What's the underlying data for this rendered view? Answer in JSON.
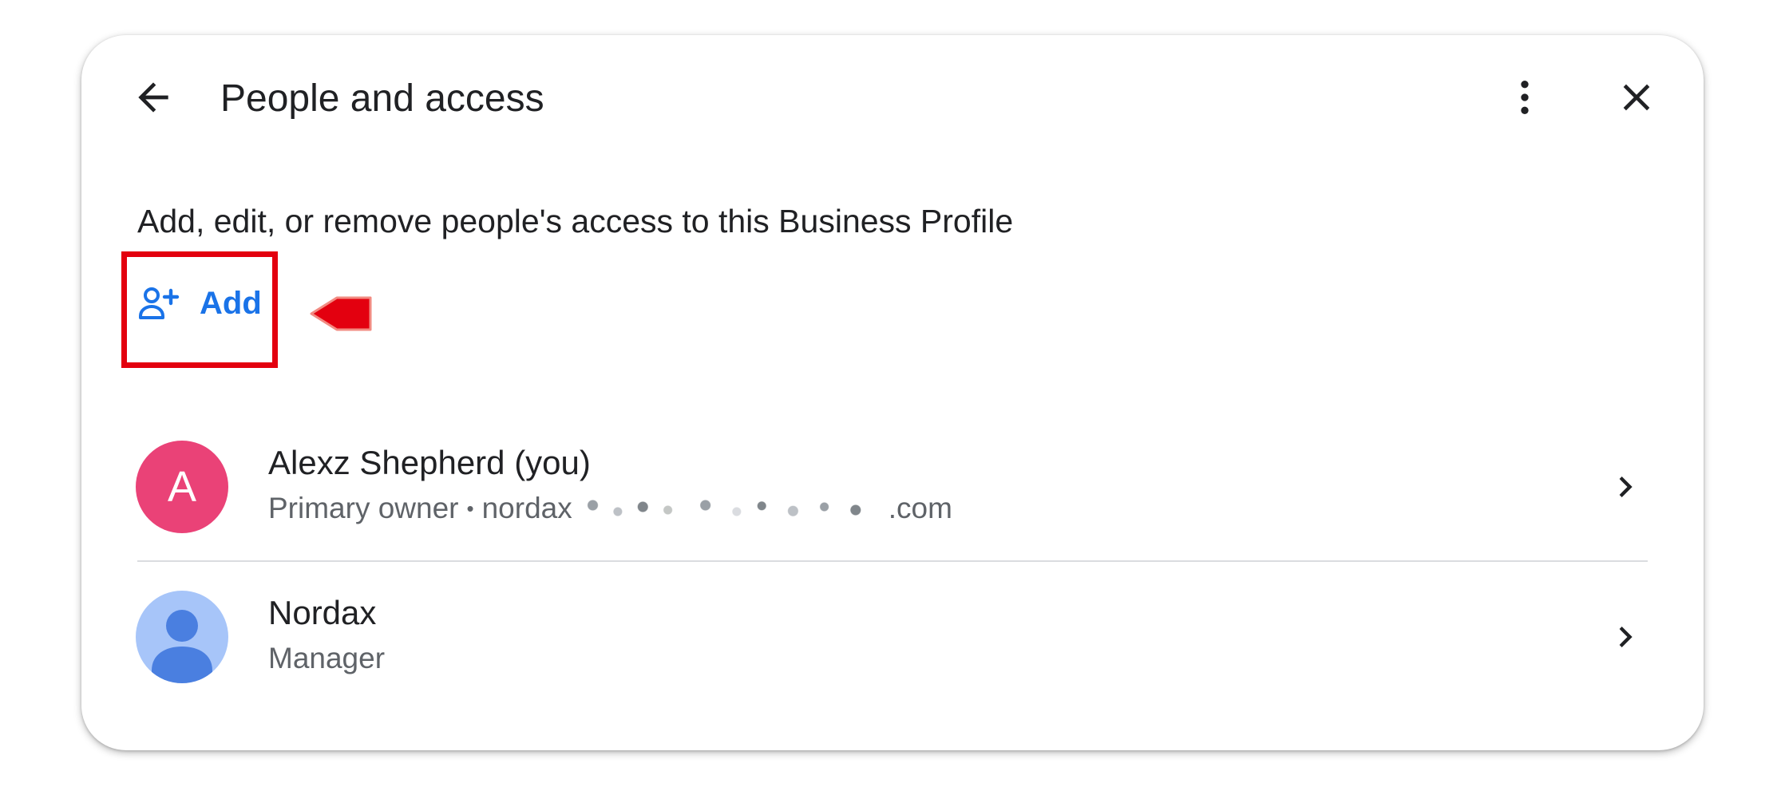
{
  "header": {
    "title": "People and access",
    "icons": {
      "back": "arrow-left-icon",
      "more": "more-vert-icon",
      "close": "close-icon"
    }
  },
  "description": "Add, edit, or remove people's access to this Business Profile",
  "add_button": {
    "label": "Add",
    "icon": "person-add-icon"
  },
  "annotation": {
    "highlight_color": "#e3000f",
    "pointer": "red-arrow-left"
  },
  "people": [
    {
      "avatar_letter": "A",
      "avatar_color": "#ea4277",
      "name": "Alexz Shepherd (you)",
      "role": "Primary owner",
      "separator": "•",
      "email_prefix": "nordax",
      "email_suffix": ".com"
    },
    {
      "avatar_icon": "person-icon",
      "avatar_color": "#a7c5f9",
      "name": "Nordax",
      "role": "Manager"
    }
  ],
  "colors": {
    "accent": "#1a73e8",
    "text_primary": "#202124",
    "text_secondary": "#5f6368"
  }
}
